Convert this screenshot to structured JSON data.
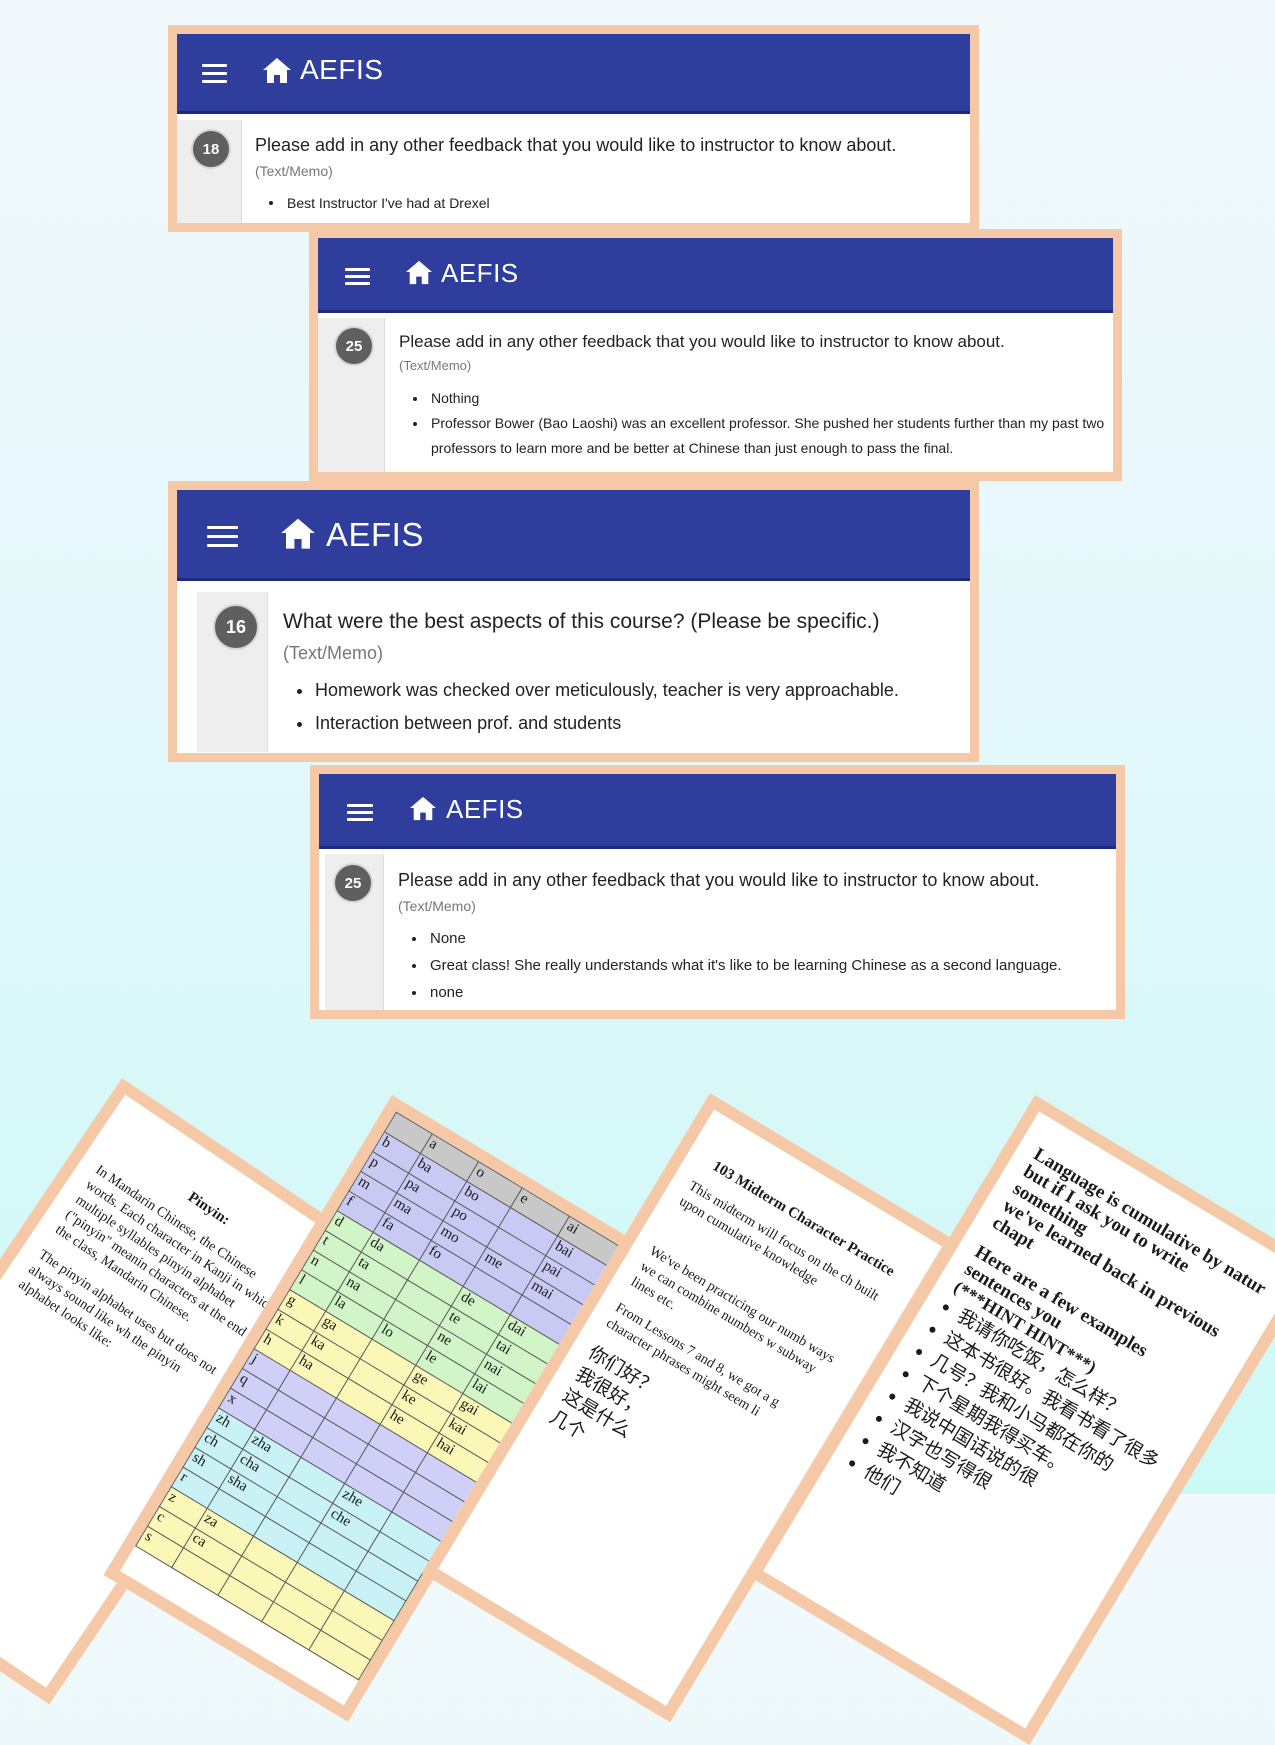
{
  "app": {
    "title": "AEFIS"
  },
  "cards": [
    {
      "number": "18",
      "question": "Please add in any other feedback that you would like to instructor to know about.",
      "type": "(Text/Memo)",
      "answers": [
        "Best Instructor I've had at Drexel"
      ]
    },
    {
      "number": "25",
      "question": "Please add in any other feedback that you would like to instructor to know about.",
      "type": "(Text/Memo)",
      "answers": [
        "Nothing",
        "Professor Bower (Bao Laoshi) was an excellent professor. She pushed her students further than my past two professors to learn more and be better at Chinese than just enough to pass the final."
      ]
    },
    {
      "number": "16",
      "question": "What were the best aspects of this course? (Please be specific.)",
      "type": "(Text/Memo)",
      "answers": [
        "Homework was checked over meticulously, teacher is very approachable.",
        "Interaction between prof. and students"
      ]
    },
    {
      "number": "25",
      "question": "Please add in any other feedback that you would like to instructor to know about.",
      "type": "(Text/Memo)",
      "answers": [
        "None",
        "Great class! She really understands what it's like to be learning Chinese as a second language.",
        "none"
      ]
    }
  ],
  "documents": {
    "pinyin": {
      "heading": "Pinyin:",
      "para1": "In Mandarin Chinese, the Chinese words. Each character in Kanji in which multiple syllables pinyin alphabet (\"pinyin\" meanin characters at the end of the class, Mandarin Chinese.",
      "para2": "The pinyin alphabet uses but does not always sound like wh the pinyin alphabet looks like:"
    },
    "table": {
      "header": [
        "",
        "a",
        "o",
        "e",
        "ai"
      ],
      "rows": [
        {
          "group": "b",
          "cells": [
            "b",
            "ba",
            "bo",
            "",
            "bai"
          ]
        },
        {
          "group": "b",
          "cells": [
            "p",
            "pa",
            "po",
            "",
            "pai"
          ]
        },
        {
          "group": "b",
          "cells": [
            "m",
            "ma",
            "mo",
            "me",
            "mai"
          ]
        },
        {
          "group": "b",
          "cells": [
            "f",
            "fa",
            "fo",
            "",
            ""
          ]
        },
        {
          "group": "d",
          "cells": [
            "d",
            "da",
            "",
            "de",
            "dai"
          ]
        },
        {
          "group": "d",
          "cells": [
            "t",
            "ta",
            "",
            "te",
            "tai"
          ]
        },
        {
          "group": "d",
          "cells": [
            "n",
            "na",
            "",
            "ne",
            "nai"
          ]
        },
        {
          "group": "d",
          "cells": [
            "l",
            "la",
            "lo",
            "le",
            "lai"
          ]
        },
        {
          "group": "g",
          "cells": [
            "g",
            "ga",
            "",
            "ge",
            "gai"
          ]
        },
        {
          "group": "g",
          "cells": [
            "k",
            "ka",
            "",
            "ke",
            "kai"
          ]
        },
        {
          "group": "g",
          "cells": [
            "h",
            "ha",
            "",
            "he",
            "hai"
          ]
        },
        {
          "group": "j",
          "cells": [
            "j",
            "",
            "",
            "",
            ""
          ]
        },
        {
          "group": "j",
          "cells": [
            "q",
            "",
            "",
            "",
            ""
          ]
        },
        {
          "group": "j",
          "cells": [
            "x",
            "",
            "",
            "",
            ""
          ]
        },
        {
          "group": "z",
          "cells": [
            "zh",
            "zha",
            "",
            "zhe",
            ""
          ]
        },
        {
          "group": "z",
          "cells": [
            "ch",
            "cha",
            "",
            "che",
            ""
          ]
        },
        {
          "group": "z",
          "cells": [
            "sh",
            "sha",
            "",
            "",
            ""
          ]
        },
        {
          "group": "z",
          "cells": [
            "r",
            "",
            "",
            "",
            ""
          ]
        },
        {
          "group": "zz",
          "cells": [
            "z",
            "za",
            "",
            "",
            ""
          ]
        },
        {
          "group": "zz",
          "cells": [
            "c",
            "ca",
            "",
            "",
            ""
          ]
        },
        {
          "group": "zz",
          "cells": [
            "s",
            "",
            "",
            "",
            ""
          ]
        }
      ]
    },
    "midterm": {
      "heading": "103 Midterm Character Practice",
      "para1": "This midterm will focus on the ch built upon cumulative knowledge",
      "para2": "We've been practicing our numb ways we can combine numbers w subway lines etc.",
      "para3": "From Lessons 7 and 8, we got a g character phrases might seem li",
      "zh": [
        "你们好？",
        "我很好，",
        "这是什么",
        "几个"
      ]
    },
    "cumulative": {
      "line1": "Language is cumulative by natur",
      "line2": "but if I ask you to write something",
      "line3": "we've learned back in previous chapt",
      "line4": "Here are a few examples sentences you",
      "line5": "(***HINT HINT***)",
      "items": [
        "我请你吃饭，怎么样？",
        "这本书很好。我看书看了很多",
        "几号？我和小马都在你的",
        "下个星期我得买车。",
        "我说中国话说的很",
        "汉字也写得很",
        "我不知道",
        "他们"
      ]
    }
  }
}
